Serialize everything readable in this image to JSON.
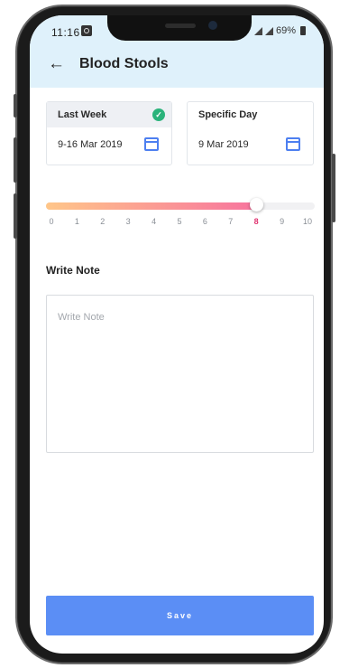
{
  "status_bar": {
    "time": "11:16",
    "battery": "69%"
  },
  "header": {
    "title": "Blood Stools",
    "back_icon": "arrow-left-icon"
  },
  "date_options": [
    {
      "label": "Last Week",
      "value": "9-16 Mar 2019",
      "selected": true
    },
    {
      "label": "Specific Day",
      "value": "9 Mar 2019",
      "selected": false
    }
  ],
  "scale": {
    "min": 0,
    "max": 10,
    "value": 8,
    "ticks": [
      "0",
      "1",
      "2",
      "3",
      "4",
      "5",
      "6",
      "7",
      "8",
      "9",
      "10"
    ]
  },
  "note": {
    "label": "Write Note",
    "placeholder": "Write Note",
    "value": ""
  },
  "save_label": "Save",
  "colors": {
    "accent": "#5b8ef5",
    "check": "#2bb37b",
    "active_tick": "#e0326f",
    "header_bg": "#dff1fb"
  }
}
